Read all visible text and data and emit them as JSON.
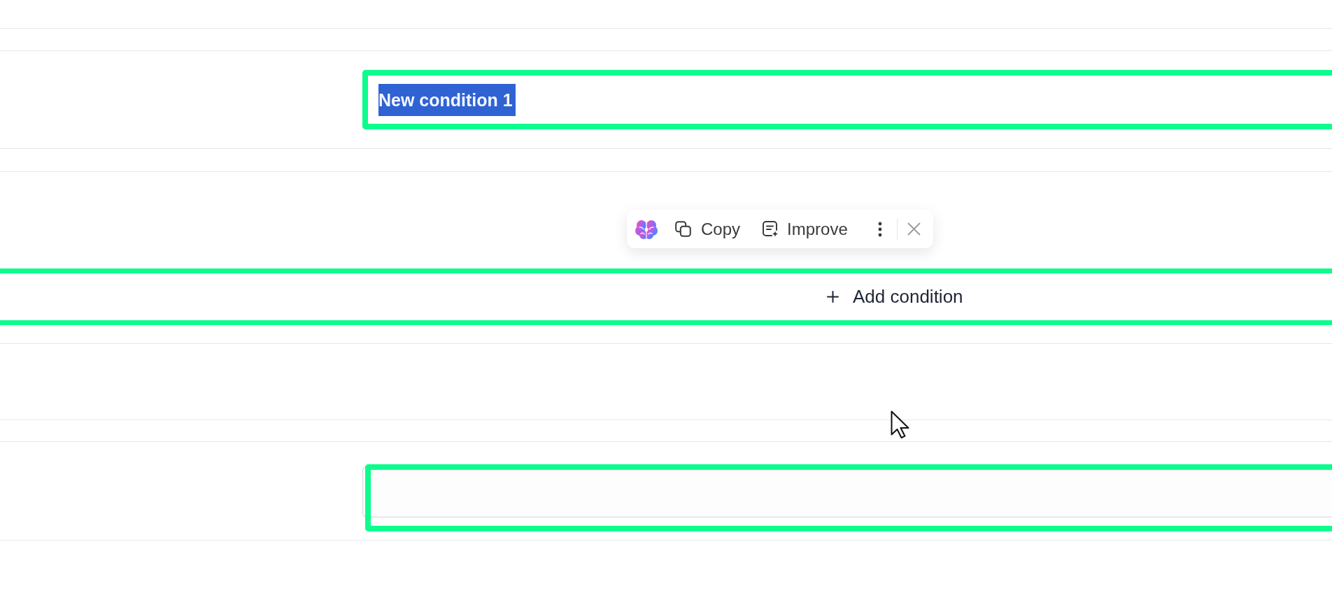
{
  "condition_field": {
    "value": "New condition 1",
    "text_selected": true,
    "highlighted": true
  },
  "text_toolbar": {
    "items": [
      {
        "kind": "brain"
      },
      {
        "kind": "copy",
        "label": "Copy"
      },
      {
        "kind": "improve",
        "label": "Improve"
      },
      {
        "kind": "more"
      },
      {
        "kind": "close"
      }
    ]
  },
  "add_condition_button": {
    "label": "Add condition",
    "highlighted": true
  },
  "empty_field": {
    "highlighted": true
  }
}
